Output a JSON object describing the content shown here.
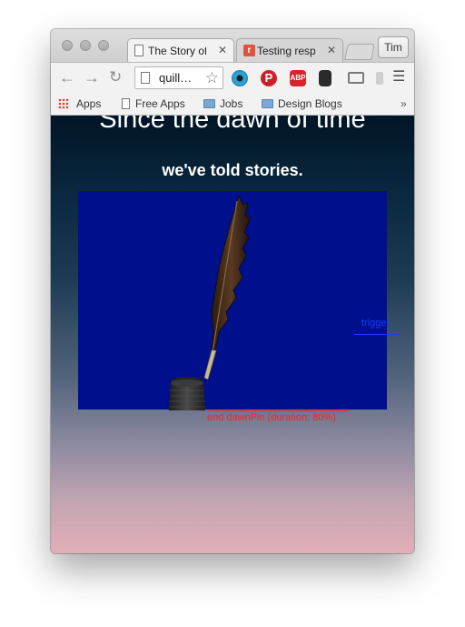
{
  "browser": {
    "tabs": [
      {
        "label": "The Story of",
        "active": true
      },
      {
        "label": "Testing respo",
        "active": false
      }
    ],
    "profile_name": "Tim",
    "omnibox_text": "quill…",
    "extensions": [
      "eye-extension-icon",
      "pinterest-icon",
      "adblock-plus-icon",
      "owl-extension-icon",
      "cast-icon",
      "menu-icon"
    ],
    "bookmarks": [
      {
        "label": "Apps",
        "icon": "apps-grid-icon"
      },
      {
        "label": "Free Apps",
        "icon": "page-icon"
      },
      {
        "label": "Jobs",
        "icon": "folder-icon"
      },
      {
        "label": "Design Blogs",
        "icon": "folder-icon"
      }
    ],
    "bookmarks_overflow": "»"
  },
  "page": {
    "headline": "Since the dawn of time",
    "subline": "we've told stories.",
    "trigger_label": "trigger",
    "end_marker_label": "end dawnPin (duration: 80%)",
    "colors": {
      "pin_box": "#000f8b",
      "trigger": "#1a3cff",
      "end_marker": "#ff2020"
    }
  }
}
